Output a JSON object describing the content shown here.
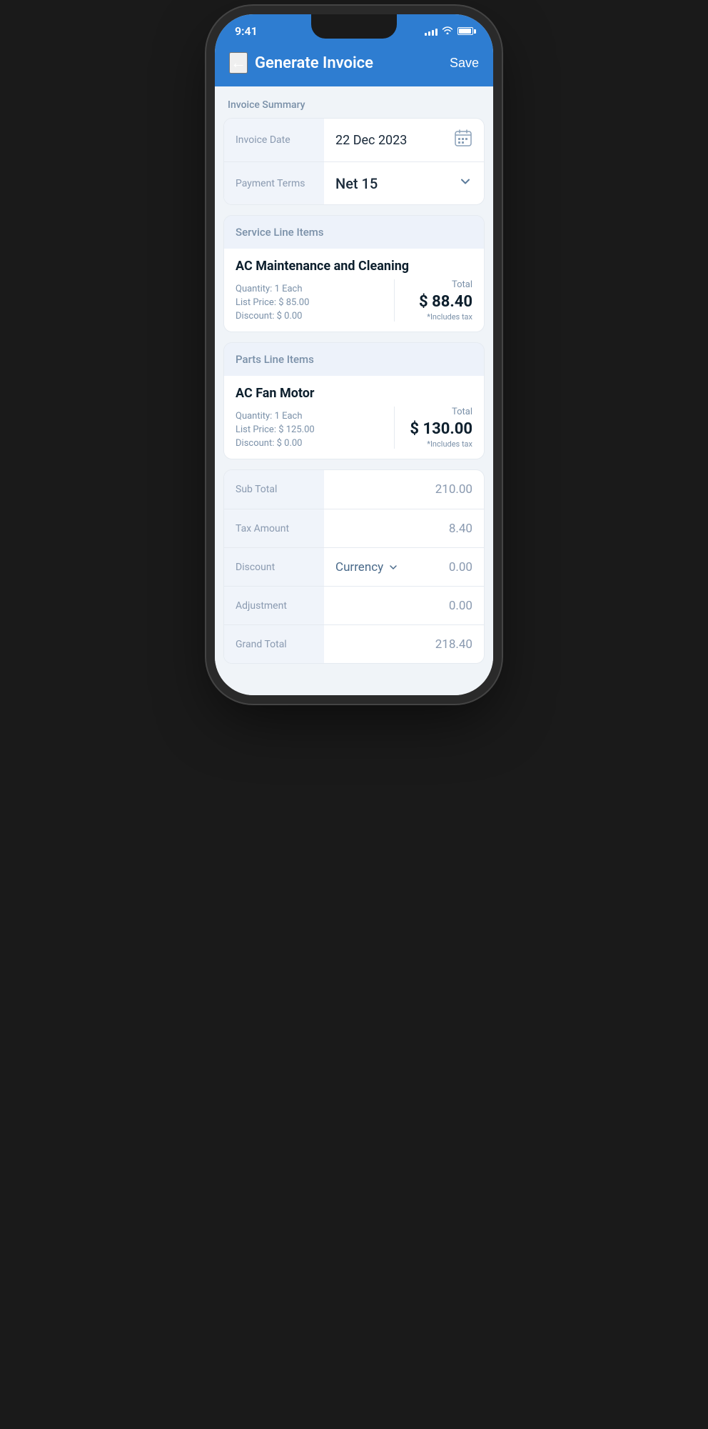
{
  "status_bar": {
    "time": "9:41",
    "signal": [
      4,
      6,
      8,
      10,
      12
    ],
    "battery_pct": 85
  },
  "header": {
    "back_label": "←",
    "title": "Generate Invoice",
    "save_label": "Save"
  },
  "invoice_summary": {
    "section_label": "Invoice Summary",
    "invoice_date_label": "Invoice Date",
    "invoice_date_value": "22 Dec 2023",
    "payment_terms_label": "Payment Terms",
    "payment_terms_value": "Net 15"
  },
  "service_line_items": {
    "section_label": "Service Line Items",
    "item_name": "AC Maintenance and Cleaning",
    "quantity_label": "Quantity:",
    "quantity_value": "1 Each",
    "list_price_label": "List Price:",
    "list_price_value": "$ 85.00",
    "discount_label": "Discount:",
    "discount_value": "$ 0.00",
    "total_label": "Total",
    "total_value": "$ 88.40",
    "tax_note": "*Includes tax"
  },
  "parts_line_items": {
    "section_label": "Parts Line Items",
    "item_name": "AC Fan Motor",
    "quantity_label": "Quantity:",
    "quantity_value": "1 Each",
    "list_price_label": "List Price:",
    "list_price_value": "$ 125.00",
    "discount_label": "Discount:",
    "discount_value": "$ 0.00",
    "total_label": "Total",
    "total_value": "$ 130.00",
    "tax_note": "*Includes tax"
  },
  "totals": {
    "sub_total_label": "Sub Total",
    "sub_total_value": "210.00",
    "tax_amount_label": "Tax Amount",
    "tax_amount_value": "8.40",
    "discount_label": "Discount",
    "currency_label": "Currency",
    "discount_value": "0.00",
    "adjustment_label": "Adjustment",
    "adjustment_value": "0.00",
    "grand_total_label": "Grand Total",
    "grand_total_value": "218.40"
  }
}
